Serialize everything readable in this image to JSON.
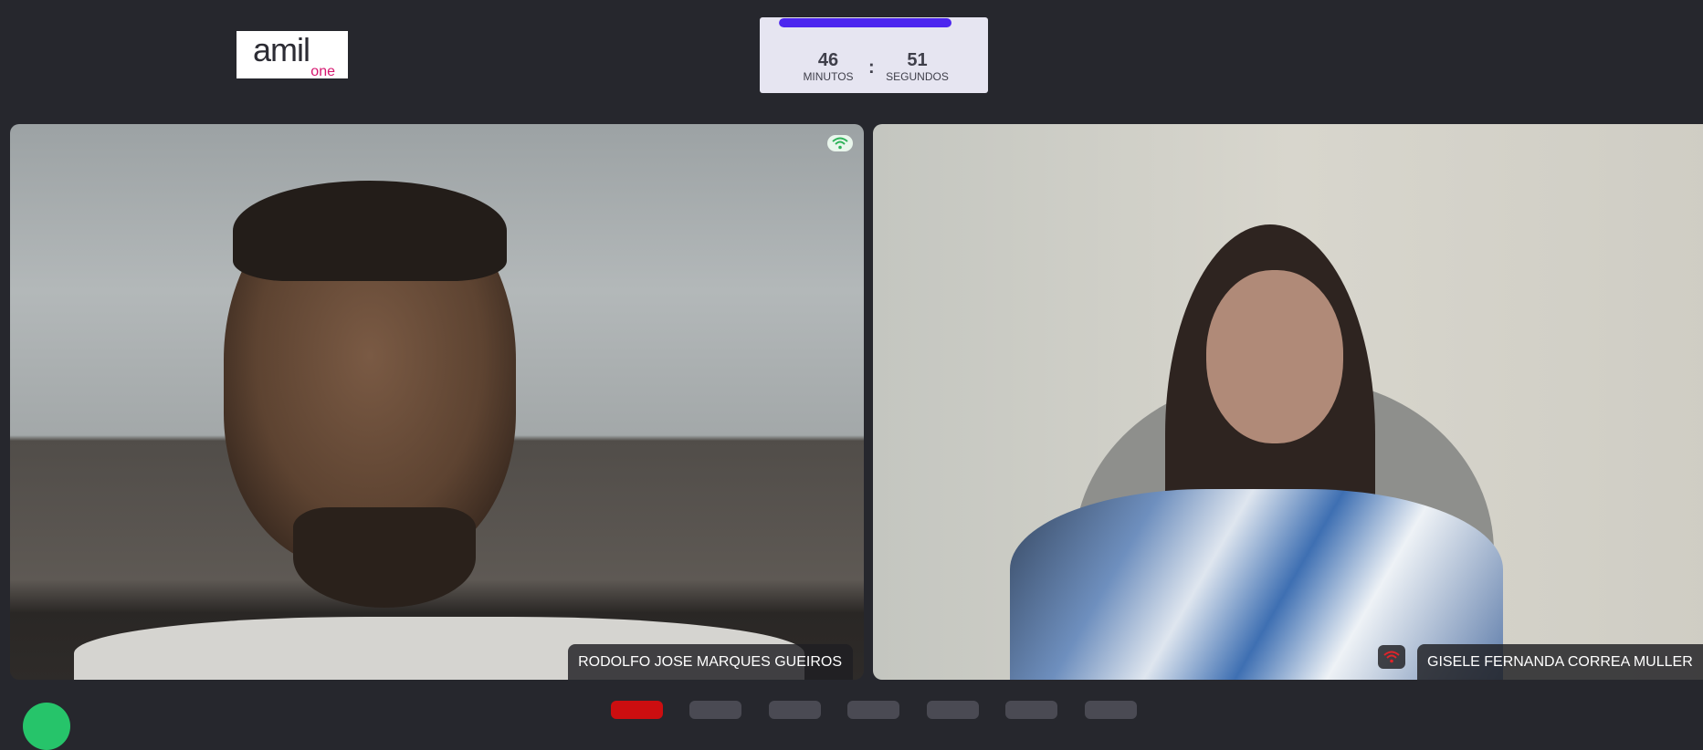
{
  "logo": {
    "brand": "amil",
    "sub": "one"
  },
  "timer": {
    "progress": 0.97,
    "minutes": "46",
    "minutes_label": "MINUTOS",
    "separator": ":",
    "seconds": "51",
    "seconds_label": "SEGUNDOS",
    "accent": "#4c26ef"
  },
  "participants": [
    {
      "name": "RODOLFO JOSE MARQUES GUEIROS",
      "connection": "good",
      "connection_color": "#2fb35a"
    },
    {
      "name": "GISELE FERNANDA CORREA MULLER",
      "connection": "poor",
      "connection_color": "#e0242a"
    }
  ],
  "controls": [
    {
      "icon": "end-call-icon",
      "color": "#cc0e10"
    },
    {
      "icon": "mic-icon"
    },
    {
      "icon": "camera-icon"
    },
    {
      "icon": "screen-share-icon"
    },
    {
      "icon": "chat-icon"
    },
    {
      "icon": "settings-icon"
    },
    {
      "icon": "more-icon"
    }
  ]
}
